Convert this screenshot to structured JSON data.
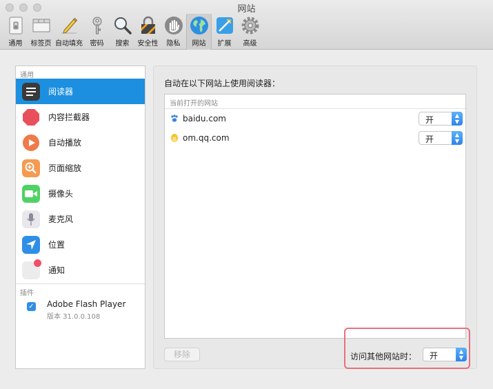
{
  "window": {
    "title": "网站"
  },
  "toolbar": {
    "items": [
      {
        "label": "通用",
        "icon": "switch-icon"
      },
      {
        "label": "标签页",
        "icon": "tabs-icon"
      },
      {
        "label": "自动填充",
        "icon": "pencil-icon"
      },
      {
        "label": "密码",
        "icon": "key-icon"
      },
      {
        "label": "搜索",
        "icon": "magnifier-icon"
      },
      {
        "label": "安全性",
        "icon": "lock-icon"
      },
      {
        "label": "隐私",
        "icon": "hand-icon"
      },
      {
        "label": "网站",
        "icon": "globe-icon",
        "active": true
      },
      {
        "label": "扩展",
        "icon": "puzzle-icon"
      },
      {
        "label": "高级",
        "icon": "gear-icon"
      }
    ]
  },
  "sidebar": {
    "general_header": "通用",
    "items": [
      {
        "label": "阅读器",
        "icon": "reader-icon",
        "selected": true
      },
      {
        "label": "内容拦截器",
        "icon": "stop-octagon-icon"
      },
      {
        "label": "自动播放",
        "icon": "play-icon"
      },
      {
        "label": "页面缩放",
        "icon": "zoom-icon"
      },
      {
        "label": "摄像头",
        "icon": "camera-icon"
      },
      {
        "label": "麦克风",
        "icon": "microphone-icon"
      },
      {
        "label": "位置",
        "icon": "location-arrow-icon"
      },
      {
        "label": "通知",
        "icon": "notification-icon"
      }
    ],
    "plugins_header": "插件",
    "plugin": {
      "name": "Adobe Flash Player",
      "version": "版本 31.0.0.108",
      "checked": true
    }
  },
  "main": {
    "heading": "自动在以下网站上使用阅读器：",
    "column_header": "当前打开的网站",
    "sites": [
      {
        "name": "baidu.com",
        "value": "开",
        "icon": "baidu-paw-icon"
      },
      {
        "name": "om.qq.com",
        "value": "开",
        "icon": "qq-penguin-icon"
      }
    ],
    "remove_button": "移除",
    "other_sites_label": "访问其他网站时：",
    "other_sites_value": "开"
  },
  "colors": {
    "accent": "#1c8fe0",
    "highlight": "#e8707c"
  }
}
